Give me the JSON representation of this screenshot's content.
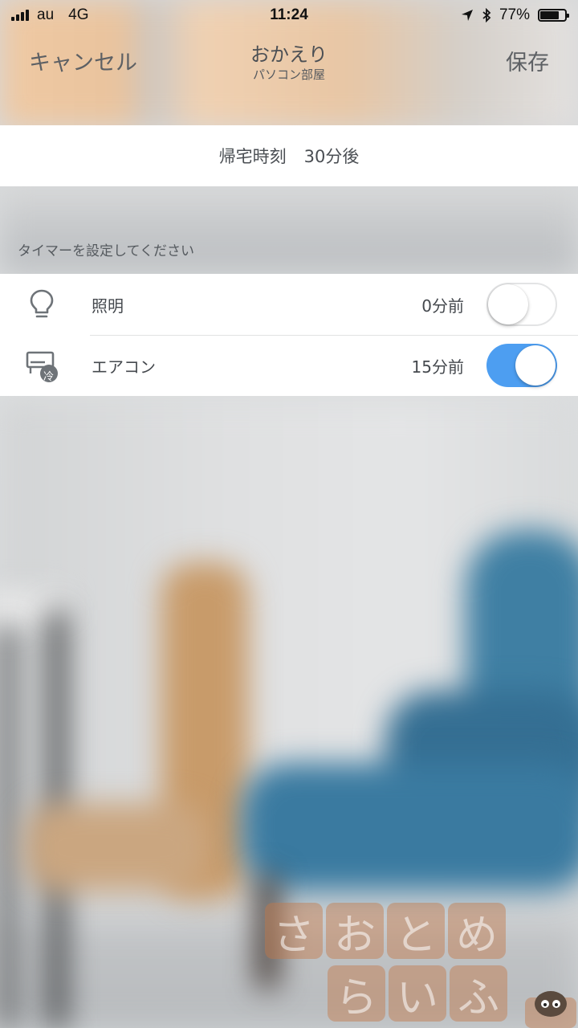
{
  "status_bar": {
    "carrier": "au",
    "network": "4G",
    "time": "11:24",
    "battery_percent": "77%",
    "battery_level": 0.77
  },
  "nav": {
    "cancel_label": "キャンセル",
    "title": "おかえり",
    "subtitle": "パソコン部屋",
    "save_label": "保存"
  },
  "return_time": {
    "label": "帰宅時刻",
    "value": "30分後"
  },
  "section_header": "タイマーを設定してください",
  "devices": [
    {
      "icon": "lightbulb-icon",
      "label": "照明",
      "value": "0分前",
      "enabled": false
    },
    {
      "icon": "air-conditioner-icon",
      "label": "エアコン",
      "value": "15分前",
      "enabled": true,
      "badge": "冷"
    }
  ],
  "watermark": {
    "row1": [
      "さ",
      "お",
      "と",
      "め"
    ],
    "row2": [
      "ら",
      "い",
      "ふ"
    ]
  },
  "colors": {
    "toggle_on": "#4d9ef1",
    "text": "#45494e"
  }
}
